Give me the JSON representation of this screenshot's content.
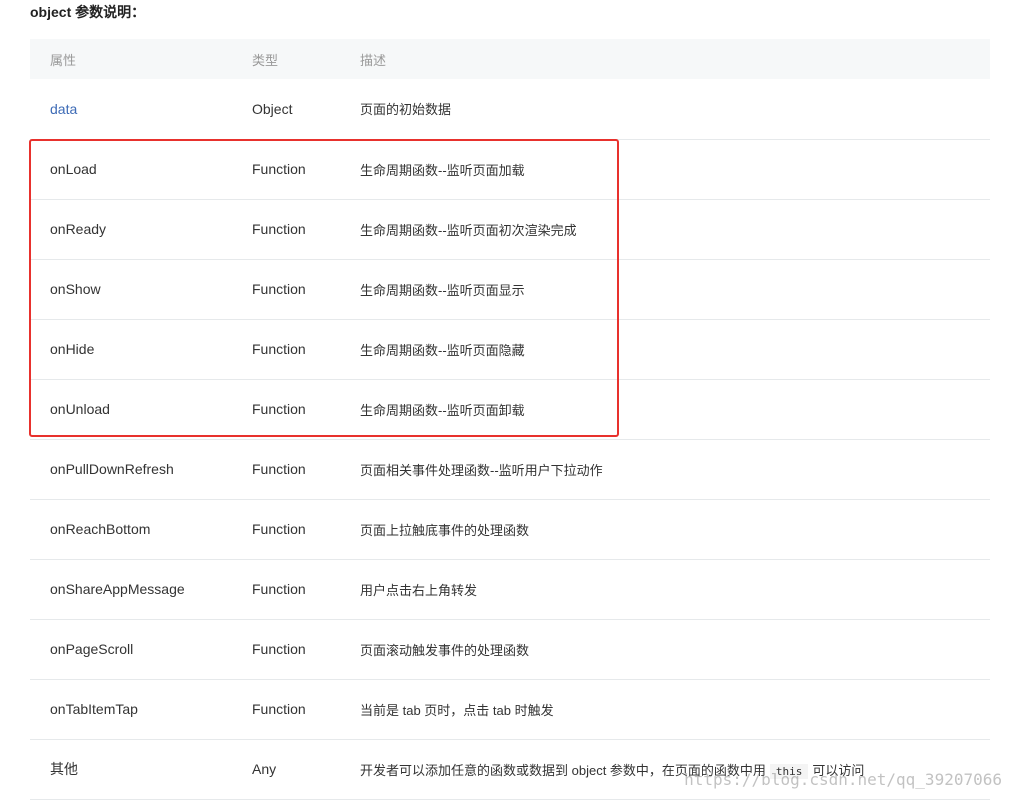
{
  "heading": "object 参数说明：",
  "table": {
    "headers": [
      "属性",
      "类型",
      "描述"
    ],
    "rows": [
      {
        "property": "data",
        "type": "Object",
        "desc": "页面的初始数据",
        "is_link": true
      },
      {
        "property": "onLoad",
        "type": "Function",
        "desc": "生命周期函数--监听页面加载"
      },
      {
        "property": "onReady",
        "type": "Function",
        "desc": "生命周期函数--监听页面初次渲染完成"
      },
      {
        "property": "onShow",
        "type": "Function",
        "desc": "生命周期函数--监听页面显示"
      },
      {
        "property": "onHide",
        "type": "Function",
        "desc": "生命周期函数--监听页面隐藏"
      },
      {
        "property": "onUnload",
        "type": "Function",
        "desc": "生命周期函数--监听页面卸载"
      },
      {
        "property": "onPullDownRefresh",
        "type": "Function",
        "desc": "页面相关事件处理函数--监听用户下拉动作"
      },
      {
        "property": "onReachBottom",
        "type": "Function",
        "desc": "页面上拉触底事件的处理函数"
      },
      {
        "property": "onShareAppMessage",
        "type": "Function",
        "desc": "用户点击右上角转发"
      },
      {
        "property": "onPageScroll",
        "type": "Function",
        "desc": "页面滚动触发事件的处理函数"
      },
      {
        "property": "onTabItemTap",
        "type": "Function",
        "desc": "当前是 tab 页时，点击 tab 时触发"
      },
      {
        "property": "其他",
        "type": "Any",
        "desc_before": "开发者可以添加任意的函数或数据到 object 参数中，在页面的函数中用",
        "desc_code": "this",
        "desc_after": "可以访问"
      }
    ]
  },
  "highlight": {
    "color": "#e8312d"
  },
  "colors": {
    "link": "#3d6bb6",
    "header_bg": "#f6f8f9",
    "border": "#e6e9eb"
  },
  "watermark": "https://blog.csdn.net/qq_39207066"
}
